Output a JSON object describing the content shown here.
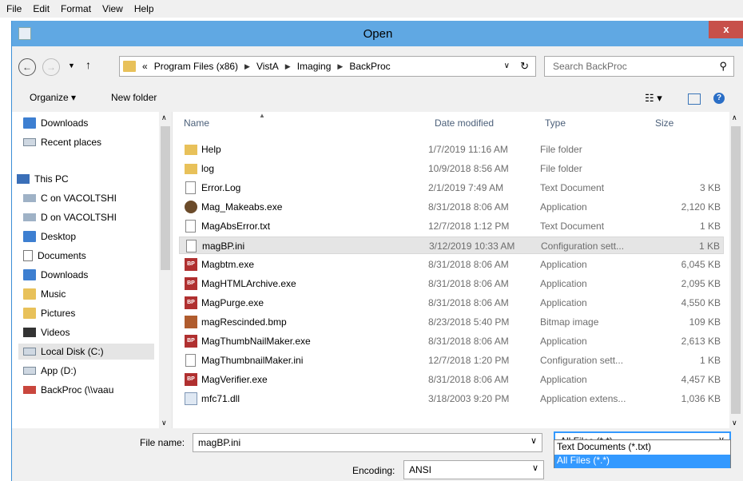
{
  "menu": [
    "File",
    "Edit",
    "Format",
    "View",
    "Help"
  ],
  "dialog": {
    "title": "Open",
    "close_label": "x"
  },
  "breadcrumb": {
    "prefix": "«",
    "parts": [
      "Program Files (x86)",
      "VistA",
      "Imaging",
      "BackProc"
    ]
  },
  "search": {
    "placeholder": "Search BackProc"
  },
  "toolbar": {
    "organize": "Organize ▾",
    "new_folder": "New folder"
  },
  "sidebar": {
    "items": [
      {
        "label": "Downloads",
        "icon": "downloads-icon"
      },
      {
        "label": "Recent places",
        "icon": "recent-places-icon"
      },
      {
        "label": "This PC",
        "icon": "computer-icon"
      },
      {
        "label": "C on VACOLTSHI",
        "icon": "network-drive-icon"
      },
      {
        "label": "D on VACOLTSHI",
        "icon": "network-drive-icon"
      },
      {
        "label": "Desktop",
        "icon": "desktop-icon"
      },
      {
        "label": "Documents",
        "icon": "documents-icon"
      },
      {
        "label": "Downloads",
        "icon": "downloads-icon"
      },
      {
        "label": "Music",
        "icon": "music-icon"
      },
      {
        "label": "Pictures",
        "icon": "pictures-icon"
      },
      {
        "label": "Videos",
        "icon": "videos-icon"
      },
      {
        "label": "Local Disk (C:)",
        "icon": "drive-icon"
      },
      {
        "label": "App (D:)",
        "icon": "drive-icon"
      },
      {
        "label": "BackProc (\\\\vaau",
        "icon": "disconnected-drive-icon"
      }
    ]
  },
  "columns": {
    "name": "Name",
    "date": "Date modified",
    "type": "Type",
    "size": "Size"
  },
  "files": [
    {
      "name": "Help",
      "date": "1/7/2019 11:16 AM",
      "type": "File folder",
      "size": "",
      "icon": "folder"
    },
    {
      "name": "log",
      "date": "10/9/2018 8:56 AM",
      "type": "File folder",
      "size": "",
      "icon": "folder"
    },
    {
      "name": "Error.Log",
      "date": "2/1/2019 7:49 AM",
      "type": "Text Document",
      "size": "3 KB",
      "icon": "doc"
    },
    {
      "name": "Mag_Makeabs.exe",
      "date": "8/31/2018 8:06 AM",
      "type": "Application",
      "size": "2,120 KB",
      "icon": "mexe"
    },
    {
      "name": "MagAbsError.txt",
      "date": "12/7/2018 1:12 PM",
      "type": "Text Document",
      "size": "1 KB",
      "icon": "doc"
    },
    {
      "name": "magBP.ini",
      "date": "3/12/2019 10:33 AM",
      "type": "Configuration sett...",
      "size": "1 KB",
      "icon": "ini"
    },
    {
      "name": "Magbtm.exe",
      "date": "8/31/2018 8:06 AM",
      "type": "Application",
      "size": "6,045 KB",
      "icon": "app"
    },
    {
      "name": "MagHTMLArchive.exe",
      "date": "8/31/2018 8:06 AM",
      "type": "Application",
      "size": "2,095 KB",
      "icon": "app"
    },
    {
      "name": "MagPurge.exe",
      "date": "8/31/2018 8:06 AM",
      "type": "Application",
      "size": "4,550 KB",
      "icon": "app"
    },
    {
      "name": "magRescinded.bmp",
      "date": "8/23/2018 5:40 PM",
      "type": "Bitmap image",
      "size": "109 KB",
      "icon": "bmp"
    },
    {
      "name": "MagThumbNailMaker.exe",
      "date": "8/31/2018 8:06 AM",
      "type": "Application",
      "size": "2,613 KB",
      "icon": "app"
    },
    {
      "name": "MagThumbnailMaker.ini",
      "date": "12/7/2018 1:20 PM",
      "type": "Configuration sett...",
      "size": "1 KB",
      "icon": "ini"
    },
    {
      "name": "MagVerifier.exe",
      "date": "8/31/2018 8:06 AM",
      "type": "Application",
      "size": "4,457 KB",
      "icon": "app"
    },
    {
      "name": "mfc71.dll",
      "date": "3/18/2003 9:20 PM",
      "type": "Application extens...",
      "size": "1,036 KB",
      "icon": "dll"
    }
  ],
  "filename": {
    "label": "File name:",
    "value": "magBP.ini"
  },
  "filetype": {
    "value": "All Files  (*.*)",
    "options": [
      "Text Documents (*.txt)",
      "All Files  (*.*)"
    ]
  },
  "encoding": {
    "label": "Encoding:",
    "value": "ANSI"
  }
}
